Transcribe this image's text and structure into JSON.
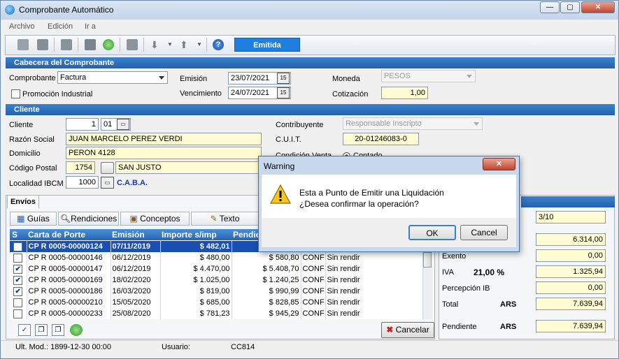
{
  "window": {
    "title": "Comprobante Automático"
  },
  "menu": [
    "Archivo",
    "Edición",
    "Ir a"
  ],
  "toolbar": {
    "status_label": "Emitida"
  },
  "cabecera": {
    "section_title": "Cabecera del Comprobante",
    "comprobante_label": "Comprobante",
    "comprobante_value": "Factura",
    "promocion_label": "Promoción Industrial",
    "emision_label": "Emisión",
    "emision_value": "23/07/2021",
    "vencimiento_label": "Vencimiento",
    "vencimiento_value": "24/07/2021",
    "moneda_label": "Moneda",
    "moneda_value": "PESOS",
    "cotizacion_label": "Cotización",
    "cotizacion_value": "1,00"
  },
  "cliente": {
    "section_title": "Cliente",
    "cliente_label": "Cliente",
    "cliente_num": "1",
    "cliente_suc": "01",
    "razon_label": "Razón Social",
    "razon_value": "JUAN MARCELO PEREZ VERDI",
    "domicilio_label": "Domicilio",
    "domicilio_value": "PERON 4128",
    "cp_label": "Código Postal",
    "cp_value": "1754",
    "cp_loc": "SAN JUSTO",
    "loc_label": "Localidad IBCM",
    "loc_value": "1000",
    "loc_name": "C.A.B.A.",
    "contrib_label": "Contribuyente",
    "contrib_value": "Responsable Inscripto",
    "cuit_label": "C.U.I.T.",
    "cuit_value": "20-01246083-0",
    "condicion_label": "Condición Venta",
    "condicion_value": "Contado"
  },
  "envios": {
    "tab_label": "Envíos",
    "subtabs": [
      "Guías",
      "Rendiciones",
      "Conceptos",
      "Texto"
    ],
    "columns": [
      "S",
      "Carta de Porte",
      "Emisión",
      "Importe s/imp",
      "Pendie"
    ],
    "rows": [
      {
        "check": "",
        "carta": "CP R 0005-00000124",
        "emision": "07/11/2019",
        "importe": "$ 482,01",
        "pend": "",
        "est": "",
        "rend": ""
      },
      {
        "check": "",
        "carta": "CP R 0005-00000146",
        "emision": "06/12/2019",
        "importe": "$ 480,00",
        "pend": "$ 580,80",
        "est": "CONF",
        "rend": "Sin rendir"
      },
      {
        "check": "✔",
        "carta": "CP R 0005-00000147",
        "emision": "06/12/2019",
        "importe": "$ 4.470,00",
        "pend": "$ 5.408,70",
        "est": "CONF",
        "rend": "Sin rendir"
      },
      {
        "check": "✔",
        "carta": "CP R 0005-00000169",
        "emision": "18/02/2020",
        "importe": "$ 1.025,00",
        "pend": "$ 1.240,25",
        "est": "CONF",
        "rend": "Sin rendir"
      },
      {
        "check": "✔",
        "carta": "CP R 0005-00000186",
        "emision": "16/03/2020",
        "importe": "$ 819,00",
        "pend": "$ 990,99",
        "est": "CONF",
        "rend": "Sin rendir"
      },
      {
        "check": "",
        "carta": "CP R 0005-00000210",
        "emision": "15/05/2020",
        "importe": "$ 685,00",
        "pend": "$ 828,85",
        "est": "CONF",
        "rend": "Sin rendir"
      },
      {
        "check": "",
        "carta": "CP R 0005-00000233",
        "emision": "25/08/2020",
        "importe": "$ 781,23",
        "pend": "$ 945,29",
        "est": "CONF",
        "rend": "Sin rendir"
      }
    ],
    "cancel_label": "Cancelar"
  },
  "totales": {
    "cuotas_value": "3/10",
    "neto_value": "6.314,00",
    "exento_label": "Exento",
    "exento_value": "0,00",
    "iva_label": "IVA",
    "iva_pct": "21,00 %",
    "iva_value": "1.325,94",
    "percepcion_label": "Percepción IB",
    "percepcion_value": "0,00",
    "total_label": "Total",
    "total_cur": "ARS",
    "total_value": "7.639,94",
    "pendiente_label": "Pendiente",
    "pendiente_cur": "ARS",
    "pendiente_value": "7.639,94"
  },
  "status": {
    "ult_mod": "Ult. Mod.: 1899-12-30 00:00",
    "usuario_label": "Usuario:",
    "usuario_value": "CC814"
  },
  "dialog": {
    "title": "Warning",
    "line1": "Esta a Punto de Emitir una Liquidación",
    "line2": "¿Desea confirmar la operación?",
    "ok_label": "OK",
    "cancel_label": "Cancel"
  }
}
